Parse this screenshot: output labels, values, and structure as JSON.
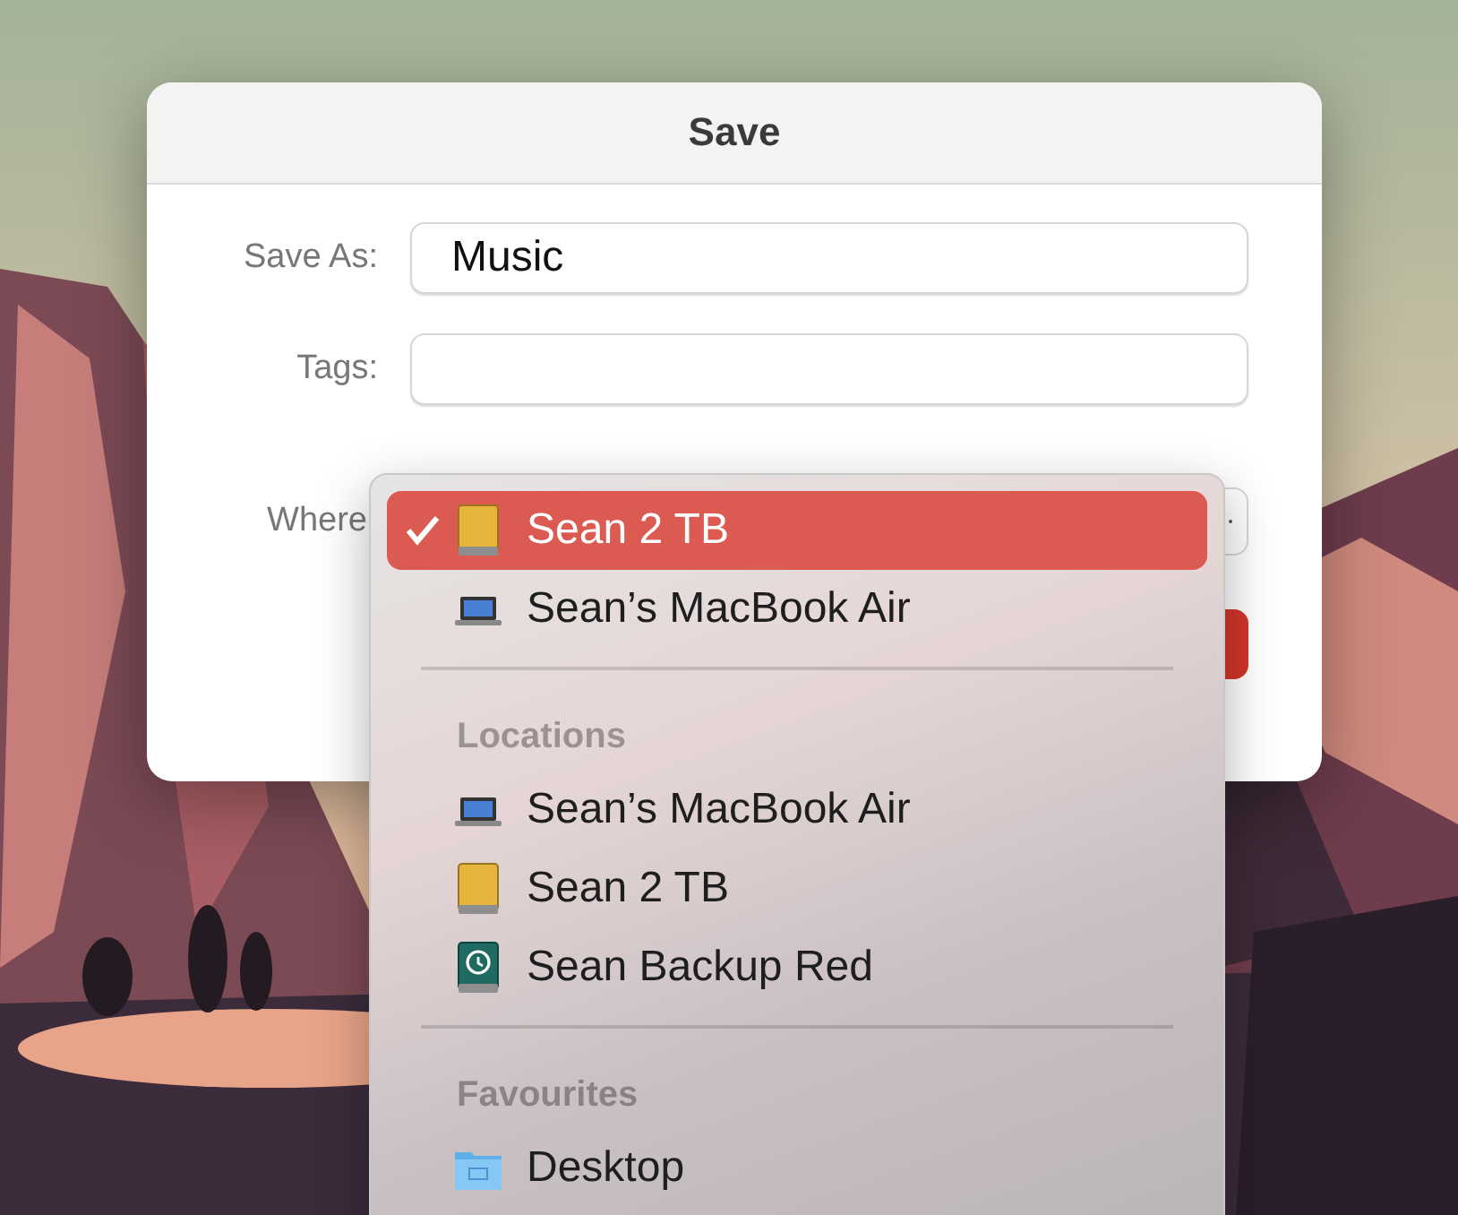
{
  "dialog": {
    "title": "Save",
    "fields": [
      {
        "label": "Save As:",
        "value": "Music"
      },
      {
        "label": "Tags:"
      }
    ],
    "where_label": "Where"
  },
  "menu": {
    "items": [
      {
        "kind": "drive",
        "label": "Sean 2 TB",
        "selected": true
      },
      {
        "kind": "laptop",
        "label": "Sean’s MacBook Air",
        "selected": false
      },
      {
        "kind": "separator"
      },
      {
        "kind": "header",
        "label": "Locations"
      },
      {
        "kind": "laptop",
        "label": "Sean’s MacBook Air",
        "selected": false
      },
      {
        "kind": "drive",
        "label": "Sean 2 TB",
        "selected": false
      },
      {
        "kind": "backup",
        "label": "Sean Backup Red",
        "selected": false
      },
      {
        "kind": "separator"
      },
      {
        "kind": "header",
        "label": "Favourites"
      },
      {
        "kind": "folder",
        "label": "Desktop",
        "selected": false
      }
    ]
  }
}
